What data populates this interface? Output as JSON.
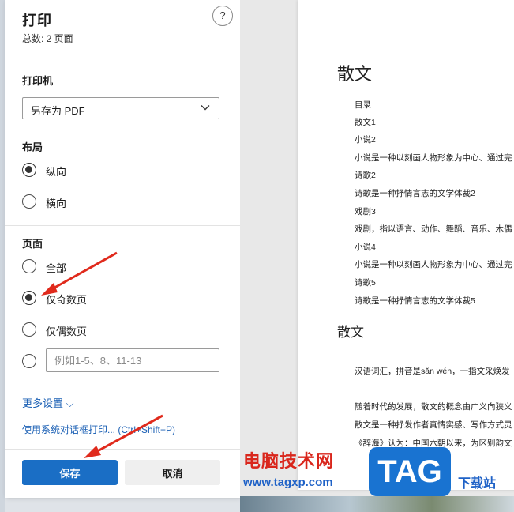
{
  "panel": {
    "title": "打印",
    "subtitle": "总数: 2 页面",
    "help_label": "?"
  },
  "printer": {
    "label": "打印机",
    "selected": "另存为 PDF"
  },
  "layout": {
    "label": "布局",
    "options": [
      {
        "label": "纵向",
        "selected": true
      },
      {
        "label": "横向",
        "selected": false
      }
    ]
  },
  "pages": {
    "label": "页面",
    "options": [
      {
        "label": "全部",
        "selected": false
      },
      {
        "label": "仅奇数页",
        "selected": true
      },
      {
        "label": "仅偶数页",
        "selected": false
      }
    ],
    "custom_placeholder": "例如1-5、8、11-13"
  },
  "more_settings": "更多设置 ⌵",
  "system_dialog_link": "使用系统对话框打印... (Ctrl+Shift+P)",
  "buttons": {
    "save": "保存",
    "cancel": "取消"
  },
  "document": {
    "heading1": "散文",
    "lines": [
      "目录",
      "散文1",
      "小说2",
      "小说是一种以刻画人物形象为中心、通过完",
      "诗歌2",
      "诗歌是一种抒情言志的文学体裁2",
      "戏剧3",
      "戏剧，指以语言、动作、舞蹈、音乐、木偶",
      "小说4",
      "小说是一种以刻画人物形象为中心、通过完",
      "诗歌5",
      "诗歌是一种抒情言志的文学体裁5"
    ],
    "heading2": "散文",
    "paragraphs": [
      "汉语词汇，拼音是sǎn wén，一指文采焕发",
      "随着时代的发展，散文的概念由广义向狭义",
      "散文是一种抒发作者真情实感、写作方式灵",
      "《辞海》认为：中国六朝以来，为区别韵文"
    ]
  },
  "watermark": {
    "site_name": "电脑技术网",
    "url": "www.tagxp.com",
    "logo": "TAG",
    "download": "下载站"
  },
  "colors": {
    "accent": "#1a6ec5",
    "arrow": "#e02a1c",
    "link": "#1a5fb4"
  }
}
